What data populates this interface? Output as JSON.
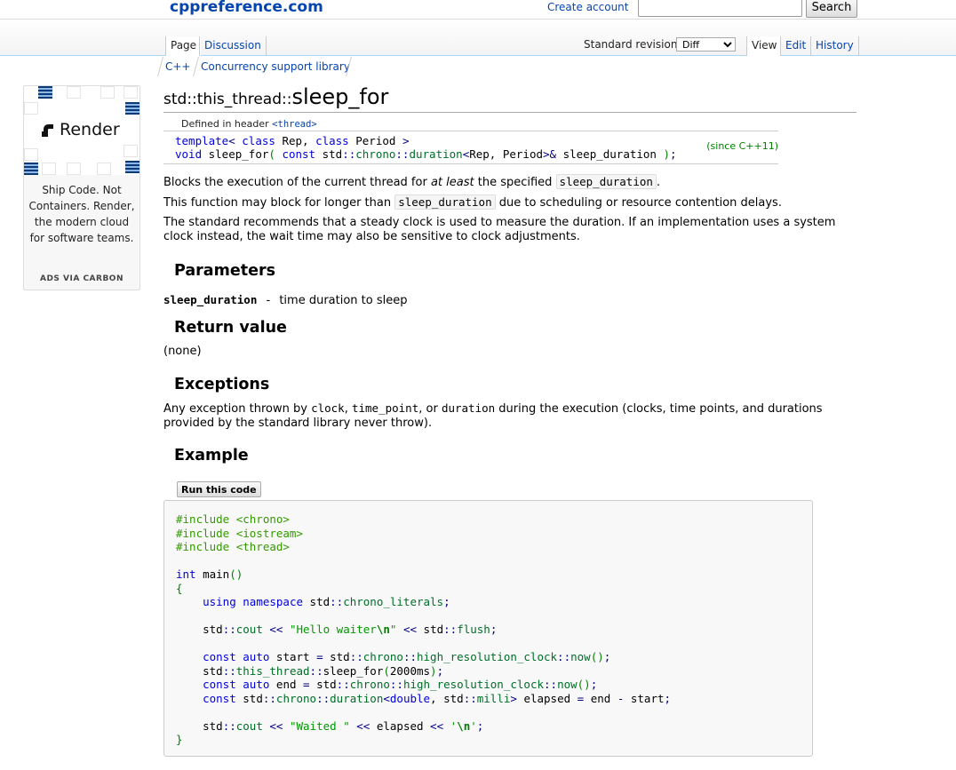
{
  "header": {
    "logo": "cppreference.com",
    "create_account": "Create account",
    "search_placeholder": "",
    "search_button": "Search"
  },
  "tabs": {
    "page": "Page",
    "discussion": "Discussion",
    "revision_label": "Standard revision:",
    "revision_value": "Diff",
    "view": "View",
    "edit": "Edit",
    "history": "History"
  },
  "breadcrumb": [
    "C++",
    "Concurrency support library"
  ],
  "ad": {
    "brand": "Render",
    "text": "Ship Code. Not Containers. Render, the modern cloud for software teams.",
    "via": "ADS VIA CARBON"
  },
  "page": {
    "title_prefix": "std::this_thread::",
    "title_name": "sleep_for",
    "defined_in": "Defined in header ",
    "header_link": "<thread>",
    "decl_line1": "template< class Rep, class Period >",
    "decl_line2": "void sleep_for( const std::chrono::duration<Rep, Period>& sleep_duration );",
    "since": "(since C++11)",
    "p1_a": "Blocks the execution of the current thread for ",
    "p1_em": "at least",
    "p1_b": " the specified ",
    "p1_code": "sleep_duration",
    "p1_c": ".",
    "p2_a": "This function may block for longer than ",
    "p2_code": "sleep_duration",
    "p2_b": " due to scheduling or resource contention delays.",
    "p3": "The standard recommends that a steady clock is used to measure the duration. If an implementation uses a system clock instead, the wait time may also be sensitive to clock adjustments.",
    "h_params": "Parameters",
    "param_name": "sleep_duration",
    "param_sep": " - ",
    "param_desc": "time duration to sleep",
    "h_return": "Return value",
    "return_text": "(none)",
    "h_exceptions": "Exceptions",
    "exc_a": "Any exception thrown by ",
    "exc_clock": "clock",
    "exc_b": ", ",
    "exc_tp": "time_point",
    "exc_c": ", or ",
    "exc_dur": "duration",
    "exc_d": " during the execution (clocks, time points, and durations provided by the standard library never throw).",
    "h_example": "Example",
    "run_button": "Run this code"
  },
  "code": [
    "#include <chrono>",
    "#include <iostream>",
    "#include <thread>",
    "",
    "int main()",
    "{",
    "    using namespace std::chrono_literals;",
    "",
    "    std::cout << \"Hello waiter\\n\" << std::flush;",
    "",
    "    const auto start = std::chrono::high_resolution_clock::now();",
    "    std::this_thread::sleep_for(2000ms);",
    "    const auto end = std::chrono::high_resolution_clock::now();",
    "    const std::chrono::duration<double, std::milli> elapsed = end - start;",
    "",
    "    std::cout << \"Waited \" << elapsed << '\\n';",
    "}"
  ]
}
